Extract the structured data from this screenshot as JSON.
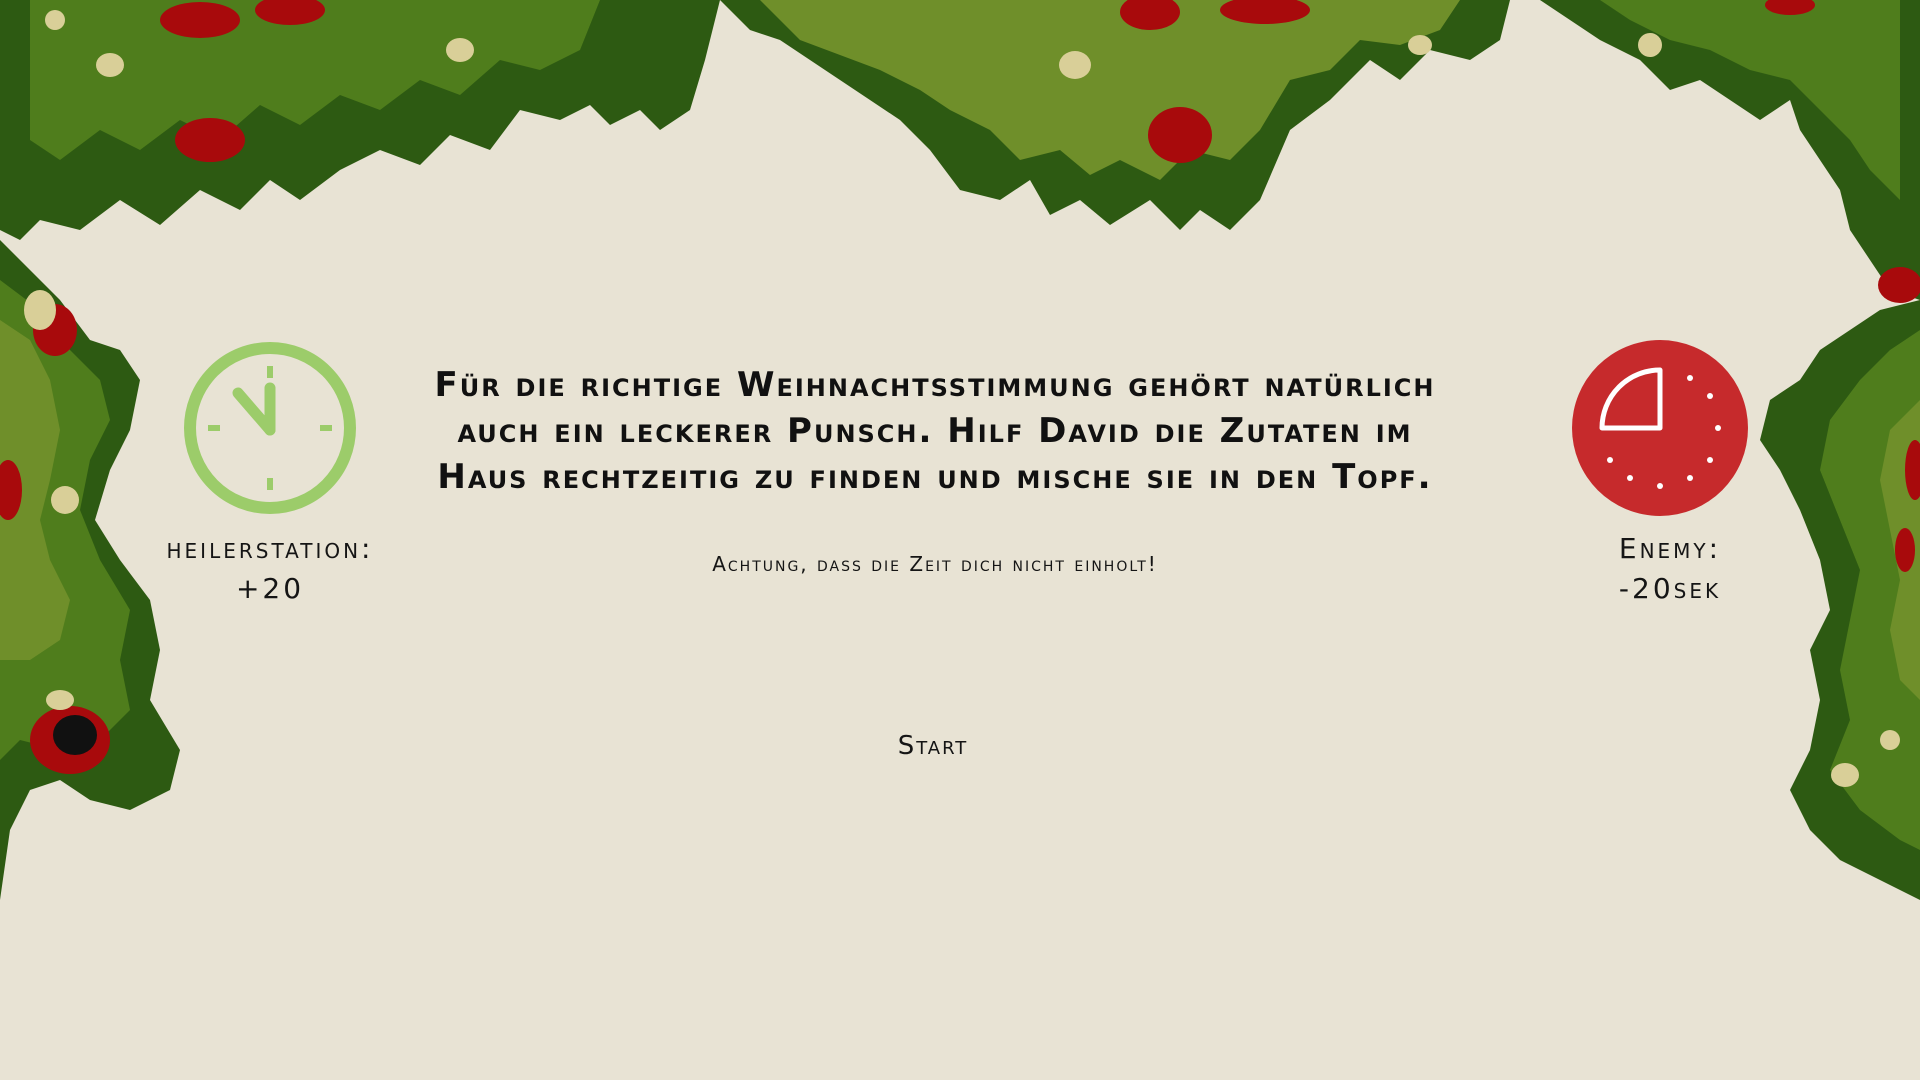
{
  "story": {
    "text": "Für die richtige Weihnachtsstimmung gehört natürlich auch ein leckerer Punsch. Hilf David die Zutaten im Haus rechtzeitig zu finden und mische sie in den Topf.",
    "warning": "Achtung, dass die Zeit dich nicht einholt!"
  },
  "heal_station": {
    "icon": "green-clock-icon",
    "label": "heilerstation:",
    "value": "+20"
  },
  "enemy": {
    "icon": "red-clock-icon",
    "label": "Enemy:",
    "value": "-20sek"
  },
  "start_label": "Start",
  "colors": {
    "background": "#e8e3d4",
    "holly_dark": "#2d5a12",
    "holly_mid": "#4f7d1c",
    "holly_light": "#6f8f2a",
    "berry_red": "#a80a0c",
    "heal_green": "#9ccc6a",
    "enemy_red": "#c62a2c"
  }
}
